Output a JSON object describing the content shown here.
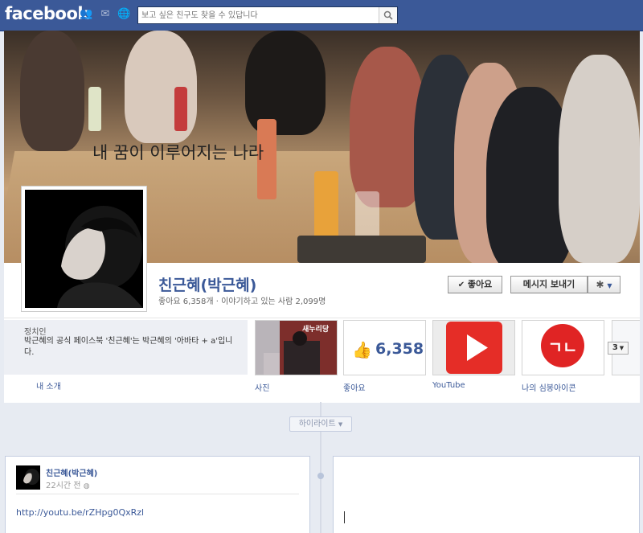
{
  "topbar": {
    "logo": "facebook",
    "search_placeholder": "보고 싶은 친구도 찾을 수 있답니다"
  },
  "cover": {
    "slogan": "내 꿈이 이루어지는 나라"
  },
  "profile": {
    "name": "친근혜(박근혜)",
    "stats": "좋아요 6,358개 · 이야기하고 있는 사람 2,099명",
    "like_button": "좋아요",
    "message_button": "메시지 보내기"
  },
  "about": {
    "category": "정치인",
    "description": "박근혜의 공식 페이스북 '친근혜'는 박근혜의 '아바타 + a'입니다.",
    "link": "내 소개"
  },
  "tiles": [
    {
      "label": "사진",
      "poster_text": "새누리당"
    },
    {
      "label": "좋아요",
      "count": "6,358"
    },
    {
      "label": "YouTube"
    },
    {
      "label": "나의 심봉아이콘",
      "logo_text": "ㄱㄴ"
    }
  ],
  "more_count": "3",
  "timeline": {
    "highlight_label": "하이라이트"
  },
  "post": {
    "author": "친근혜(박근혜)",
    "time": "22시간 전",
    "link": "http://youtu.be/rZHpg0QxRzl"
  },
  "colors": {
    "brand": "#3b5998",
    "youtube_red": "#e52d27"
  }
}
